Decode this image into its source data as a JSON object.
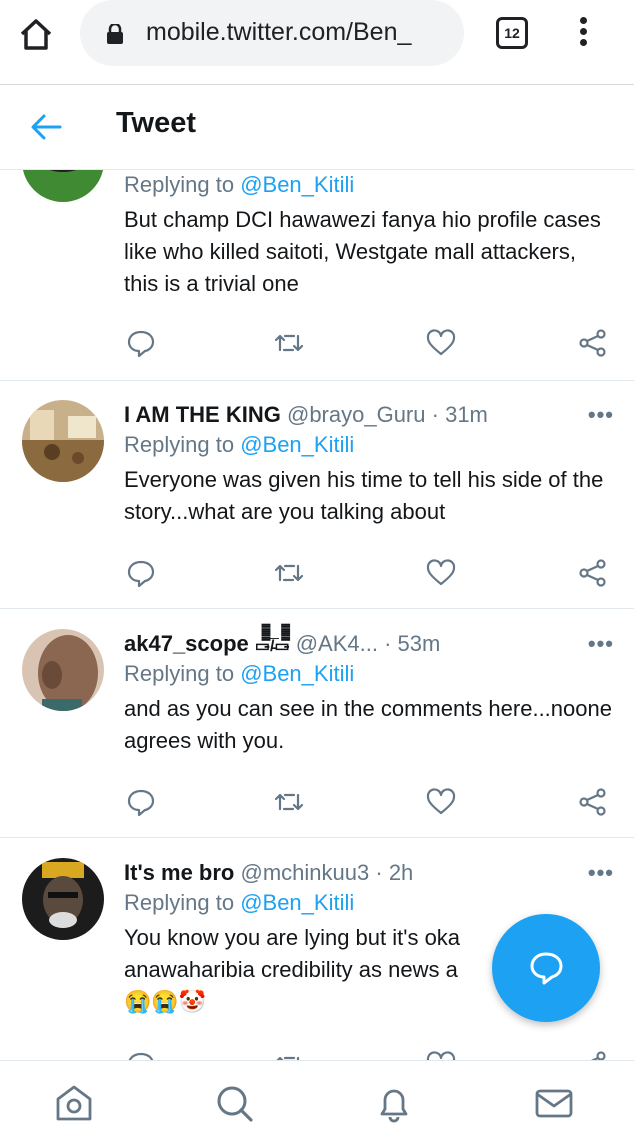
{
  "browser": {
    "url": "mobile.twitter.com/Ben_",
    "tab_count": "12"
  },
  "header": {
    "title": "Tweet"
  },
  "tweets": [
    {
      "name": "",
      "handle": "",
      "time": "",
      "reply_prefix": "Replying to ",
      "reply_to": "@Ben_Kitili",
      "text": "But champ DCI hawawezi fanya hio profile cases like who killed saitoti, Westgate mall attackers, this is a trivial one",
      "avatar_color": "#3a7a2a"
    },
    {
      "name": "I AM THE KING",
      "handle": "@brayo_Guru",
      "time": "31m",
      "reply_prefix": "Replying to ",
      "reply_to": "@Ben_Kitili",
      "text": "Everyone was given his time to tell his side of the story...what are you talking about",
      "avatar_color": "#b89a6a"
    },
    {
      "name": "ak47_scope",
      "name_glyphs": "▭̵̅̅̅̅̅̅̅̅/̵̅̅̅̅̅̅̅̅▭̵̅̅̅̅̅̅̅̅",
      "handle": "@AK4...",
      "time": "53m",
      "reply_prefix": "Replying to ",
      "reply_to": "@Ben_Kitili",
      "text": "and as you can see in the comments here...noone agrees with you.",
      "avatar_color": "#8b6650"
    },
    {
      "name": "It's me bro",
      "handle": "@mchinkuu3",
      "time": "2h",
      "reply_prefix": "Replying to ",
      "reply_to": "@Ben_Kitili",
      "text": "You know you are lying but it's oka anawaharibia credibility as news a",
      "emoji": "😭😭🤡",
      "avatar_color": "#2a2a2a"
    }
  ],
  "dot": "·",
  "more": "•••",
  "icons": {
    "home": "home-icon",
    "search": "search-icon",
    "notifications": "bell-icon",
    "messages": "mail-icon",
    "compose": "compose-reply-icon"
  },
  "colors": {
    "accent": "#1da1f2",
    "secondary_text": "#657786",
    "border": "#e1e8ed"
  }
}
